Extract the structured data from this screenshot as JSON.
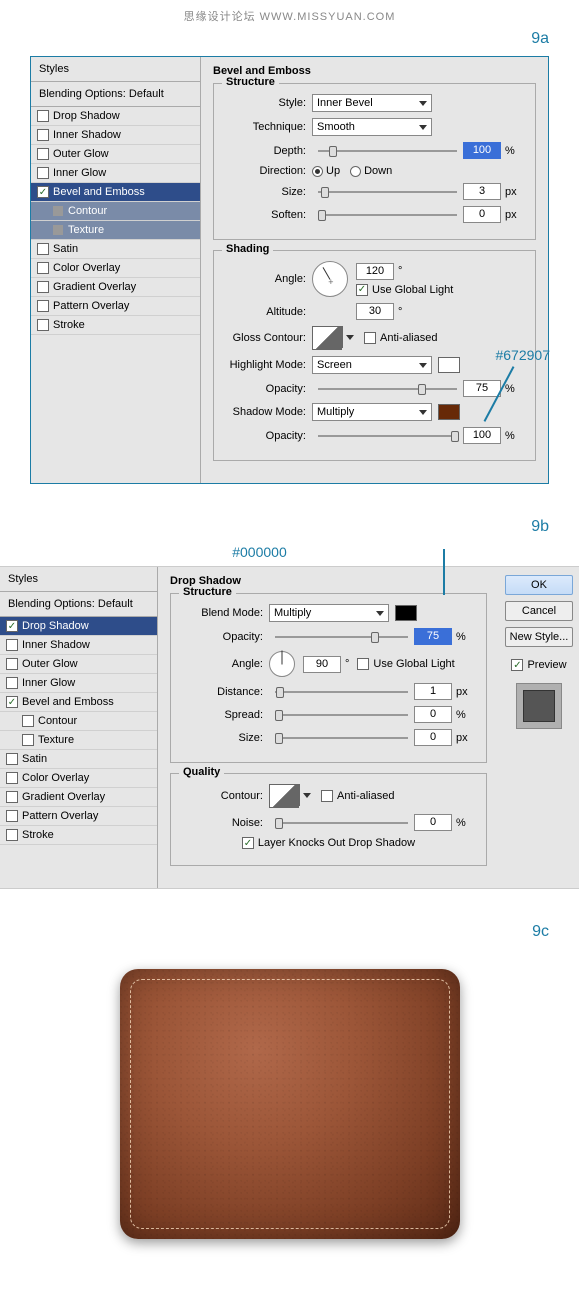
{
  "header": "思缘设计论坛  WWW.MISSYUAN.COM",
  "steps": {
    "a": "9a",
    "b": "9b",
    "c": "9c"
  },
  "styles_header": "Styles",
  "blending_opts": "Blending Options: Default",
  "style_items": [
    "Drop Shadow",
    "Inner Shadow",
    "Outer Glow",
    "Inner Glow",
    "Bevel and Emboss",
    "Contour",
    "Texture",
    "Satin",
    "Color Overlay",
    "Gradient Overlay",
    "Pattern Overlay",
    "Stroke"
  ],
  "panel9a": {
    "title": "Bevel and Emboss",
    "structure": {
      "legend": "Structure",
      "style_label": "Style:",
      "style_value": "Inner Bevel",
      "technique_label": "Technique:",
      "technique_value": "Smooth",
      "depth_label": "Depth:",
      "depth_value": "100",
      "depth_unit": "%",
      "direction_label": "Direction:",
      "up": "Up",
      "down": "Down",
      "size_label": "Size:",
      "size_value": "3",
      "size_unit": "px",
      "soften_label": "Soften:",
      "soften_value": "0",
      "soften_unit": "px"
    },
    "shading": {
      "legend": "Shading",
      "angle_label": "Angle:",
      "angle_value": "120",
      "angle_unit": "°",
      "global_light": "Use Global Light",
      "altitude_label": "Altitude:",
      "altitude_value": "30",
      "altitude_unit": "°",
      "gloss_label": "Gloss Contour:",
      "anti": "Anti-aliased",
      "highlight_label": "Highlight Mode:",
      "highlight_value": "Screen",
      "h_opacity_label": "Opacity:",
      "h_opacity_value": "75",
      "h_opacity_unit": "%",
      "shadow_label": "Shadow Mode:",
      "shadow_value": "Multiply",
      "shadow_color": "#672907",
      "s_opacity_label": "Opacity:",
      "s_opacity_value": "100",
      "s_opacity_unit": "%"
    },
    "annotation": "#672907"
  },
  "panel9b": {
    "title": "Drop Shadow",
    "annotation": "#000000",
    "structure": {
      "legend": "Structure",
      "blend_label": "Blend Mode:",
      "blend_value": "Multiply",
      "blend_color": "#000000",
      "opacity_label": "Opacity:",
      "opacity_value": "75",
      "opacity_unit": "%",
      "angle_label": "Angle:",
      "angle_value": "90",
      "angle_unit": "°",
      "global_light": "Use Global Light",
      "distance_label": "Distance:",
      "distance_value": "1",
      "distance_unit": "px",
      "spread_label": "Spread:",
      "spread_value": "0",
      "spread_unit": "%",
      "size_label": "Size:",
      "size_value": "0",
      "size_unit": "px"
    },
    "quality": {
      "legend": "Quality",
      "contour_label": "Contour:",
      "anti": "Anti-aliased",
      "noise_label": "Noise:",
      "noise_value": "0",
      "noise_unit": "%",
      "knockout": "Layer Knocks Out Drop Shadow"
    },
    "buttons": {
      "ok": "OK",
      "cancel": "Cancel",
      "new_style": "New Style...",
      "preview": "Preview"
    }
  }
}
